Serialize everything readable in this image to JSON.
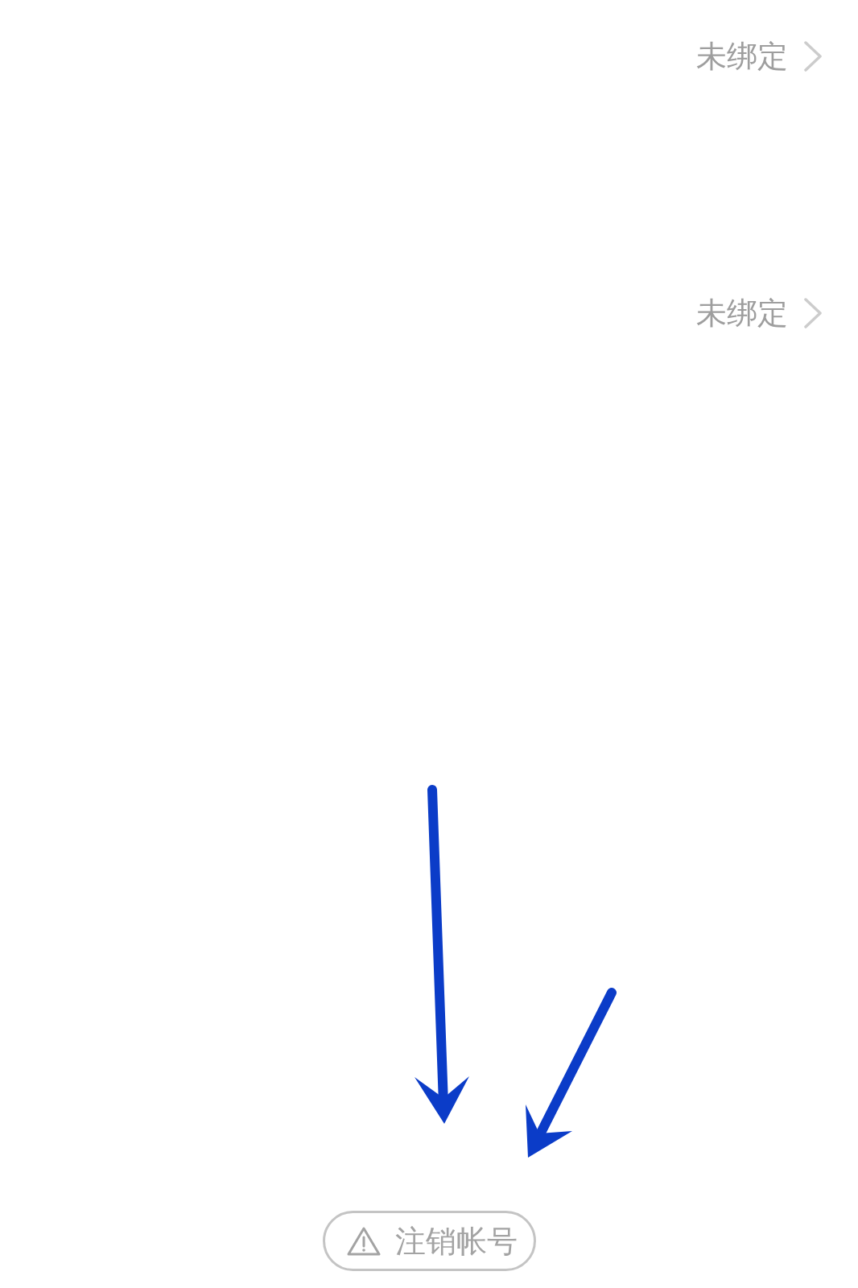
{
  "rows": [
    {
      "value": "未绑定"
    },
    {
      "value": "未绑定"
    }
  ],
  "button": {
    "label": "注销帐号"
  }
}
